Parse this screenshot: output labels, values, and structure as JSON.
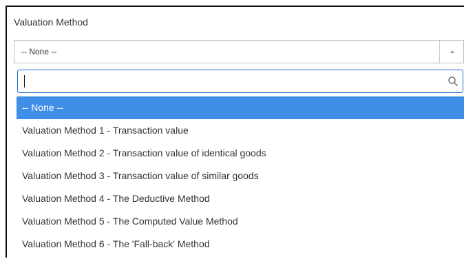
{
  "field": {
    "label": "Valuation Method",
    "selected_value": "-- None --"
  },
  "dropdown": {
    "search_value": "",
    "options": [
      {
        "label": "-- None --",
        "selected": true
      },
      {
        "label": "Valuation Method 1 - Transaction value",
        "selected": false
      },
      {
        "label": "Valuation Method 2 - Transaction value of identical goods",
        "selected": false
      },
      {
        "label": "Valuation Method 3 - Transaction value of similar goods",
        "selected": false
      },
      {
        "label": "Valuation Method 4 - The Deductive Method",
        "selected": false
      },
      {
        "label": "Valuation Method 5 - The Computed Value Method",
        "selected": false
      },
      {
        "label": "Valuation Method 6 - The 'Fall-back' Method",
        "selected": false
      }
    ]
  },
  "icons": {
    "caret": "caret-up-icon",
    "search": "search-icon"
  },
  "colors": {
    "selected_option_bg": "#3f8fe8",
    "focus_border": "#1b6fc9"
  }
}
